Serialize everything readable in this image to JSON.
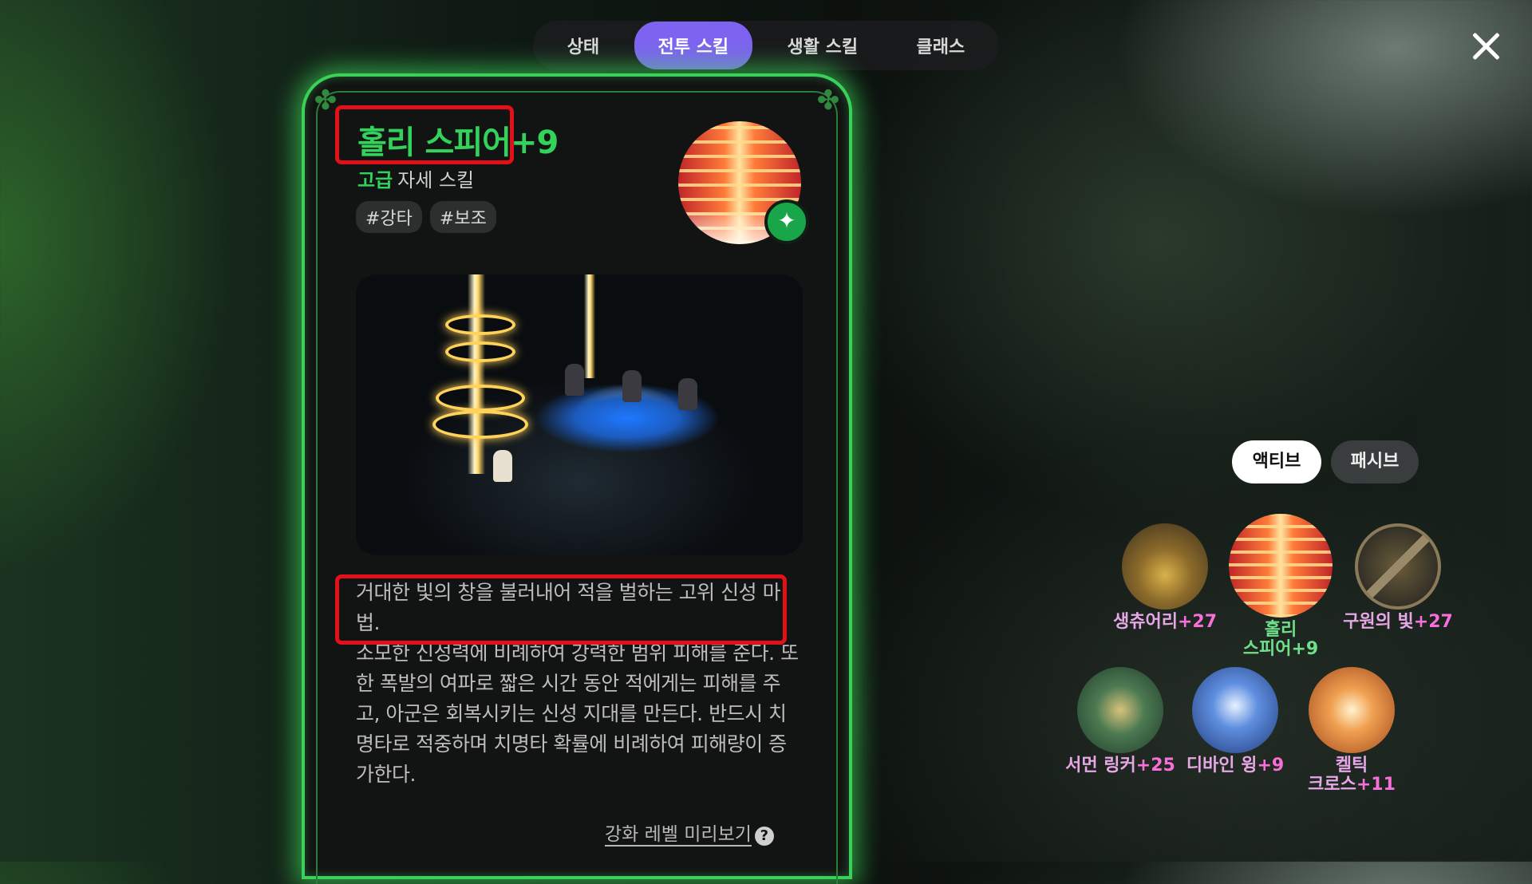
{
  "tabs": [
    {
      "label": "상태",
      "active": false
    },
    {
      "label": "전투 스킬",
      "active": true
    },
    {
      "label": "생활 스킬",
      "active": false
    },
    {
      "label": "클래스",
      "active": false
    }
  ],
  "skill": {
    "name": "홀리 스피어",
    "level": "+9",
    "grade": "고급",
    "type_label": "자세 스킬",
    "tags": [
      "#강타",
      "#보조"
    ],
    "description_highlighted": "거대한 빛의 창을 불러내어 적을 벌하는 고위 신성 마법.",
    "description_rest": "소모한 신성력에 비례하여 강력한 범위 피해를 준다. 또한 폭발의 여파로 짧은 시간 동안 적에게는 피해를 주고, 아군은 회복시키는 신성 지대를 만든다. 반드시 치명타로 적중하며 치명타 확률에 비례하여 피해량이 증가한다.",
    "enhance_preview": "강화 레벨 미리보기",
    "help_glyph": "?"
  },
  "skill_type_toggle": {
    "active": "액티브",
    "passive": "패시브"
  },
  "skill_slots": [
    {
      "name": "생츄어리",
      "level": "+27",
      "icon": "sanctuary-icon"
    },
    {
      "name": "홀리 스피어",
      "line1": "홀리",
      "line2": "스피어",
      "level": "+9",
      "icon": "holy-spear-icon",
      "selected": true
    },
    {
      "name": "구원의 빛",
      "level": "+27",
      "icon": "light-of-salvation-icon",
      "disabled": true
    },
    {
      "name": "서먼 링커",
      "level": "+25",
      "icon": "summon-linker-icon"
    },
    {
      "name": "디바인 윙",
      "level": "+9",
      "icon": "divine-wing-icon"
    },
    {
      "name": "켈틱 크로스",
      "line1": "켈틱",
      "line2": "크로스",
      "level": "+11",
      "icon": "celtic-cross-icon"
    }
  ],
  "colors": {
    "accent_purple": "#7e63f0",
    "skill_green": "#32d25b",
    "highlight_red": "#e3101a",
    "level_pink": "#f76fd8"
  }
}
